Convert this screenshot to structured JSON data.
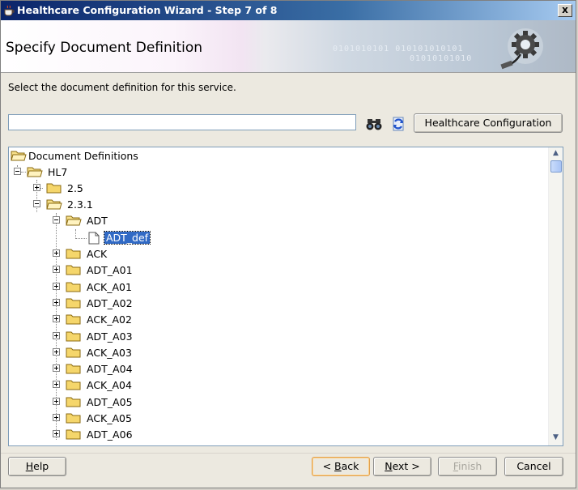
{
  "window": {
    "title": "Healthcare Configuration Wizard - Step 7 of 8",
    "close_label": "x"
  },
  "header": {
    "page_title": "Specify Document Definition",
    "binary_text_1": "0101010101  010101010101",
    "binary_text_2": "01010101010"
  },
  "instruction": "Select the document definition for this service.",
  "search": {
    "value": "",
    "placeholder": ""
  },
  "toolbar": {
    "find_icon": "binoculars-icon",
    "refresh_icon": "refresh-icon",
    "healthcare_config_label": "Healthcare Configuration"
  },
  "tree": {
    "root": "Document Definitions",
    "hl7": "HL7",
    "v25": "2.5",
    "v231": "2.3.1",
    "adt": "ADT",
    "adt_def": "ADT_def",
    "items": [
      "ACK",
      "ADT_A01",
      "ACK_A01",
      "ADT_A02",
      "ACK_A02",
      "ADT_A03",
      "ACK_A03",
      "ADT_A04",
      "ACK_A04",
      "ADT_A05",
      "ACK_A05",
      "ADT_A06"
    ]
  },
  "footer": {
    "help_pre": "",
    "help_u": "H",
    "help_post": "elp",
    "back_pre": "< ",
    "back_u": "B",
    "back_post": "ack",
    "next_pre": "",
    "next_u": "N",
    "next_post": "ext >",
    "finish_pre": "",
    "finish_u": "F",
    "finish_post": "inish",
    "cancel_label": "Cancel"
  },
  "colors": {
    "title_bar": "#0a246a",
    "selection": "#316ac5",
    "folder": "#f5d66b"
  }
}
